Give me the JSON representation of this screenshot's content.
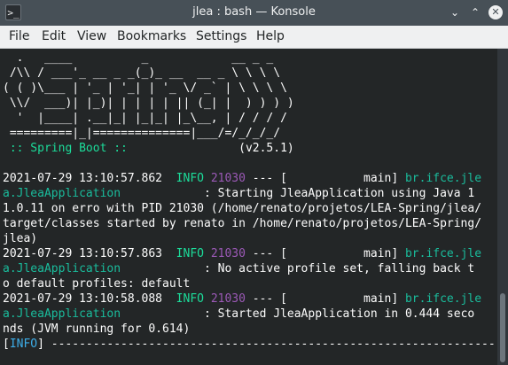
{
  "window": {
    "title": "jlea : bash — Konsole",
    "app_icon": ">_",
    "buttons": {
      "minimize": "⌄",
      "maximize": "⌃",
      "close": "✕"
    }
  },
  "menu": [
    "File",
    "Edit",
    "View",
    "Bookmarks",
    "Settings",
    "Help"
  ],
  "terminal": {
    "banner": [
      "  .   ____          _            __ _ _",
      " /\\\\ / ___'_ __ _ _(_)_ __  __ _ \\ \\ \\ \\",
      "( ( )\\___ | '_ | '_| | '_ \\/ _` | \\ \\ \\ \\",
      " \\\\/  ___)| |_)| | | | | || (_| |  ) ) ) )",
      "  '  |____| .__|_| |_|_| |_\\__, | / / / /",
      " =========|_|==============|___/=/_/_/_/"
    ],
    "spring_boot": " :: Spring Boot :: ",
    "spring_version": "               (v2.5.1)",
    "logs": [
      {
        "timestamp": "2021-07-29 13:10:57.862",
        "level": "INFO",
        "pid": "21030",
        "sep": " --- [           main] ",
        "logger_a": "br.ifce.jle",
        "logger_b": "a.JleaApplication",
        "msg_first": "            : Starting JleaApplication using Java 1",
        "msg_rest": [
          "1.0.11 on erro with PID 21030 (/home/renato/projetos/LEA-Spring/jlea/",
          "target/classes started by renato in /home/renato/projetos/LEA-Spring/",
          "jlea)"
        ]
      },
      {
        "timestamp": "2021-07-29 13:10:57.863",
        "level": "INFO",
        "pid": "21030",
        "sep": " --- [           main] ",
        "logger_a": "br.ifce.jle",
        "logger_b": "a.JleaApplication",
        "msg_first": "            : No active profile set, falling back t",
        "msg_rest": [
          "o default profiles: default"
        ]
      },
      {
        "timestamp": "2021-07-29 13:10:58.088",
        "level": "INFO",
        "pid": "21030",
        "sep": " --- [           main] ",
        "logger_a": "br.ifce.jle",
        "logger_b": "a.JleaApplication",
        "msg_first": "            : Started JleaApplication in 0.444 seco",
        "msg_rest": [
          "nds (JVM running for 0.614)"
        ]
      }
    ],
    "last_line": {
      "open": "[",
      "tag": "INFO",
      "rest": "] ------------------------------------------------------------------------"
    }
  },
  "colors": {
    "background": "#232627",
    "text": "#fcfcfc",
    "info_green": "#1cdc9a",
    "pid_magenta": "#9b59b6",
    "logger_cyan": "#1abc9c",
    "tag_blue": "#3daee9"
  }
}
